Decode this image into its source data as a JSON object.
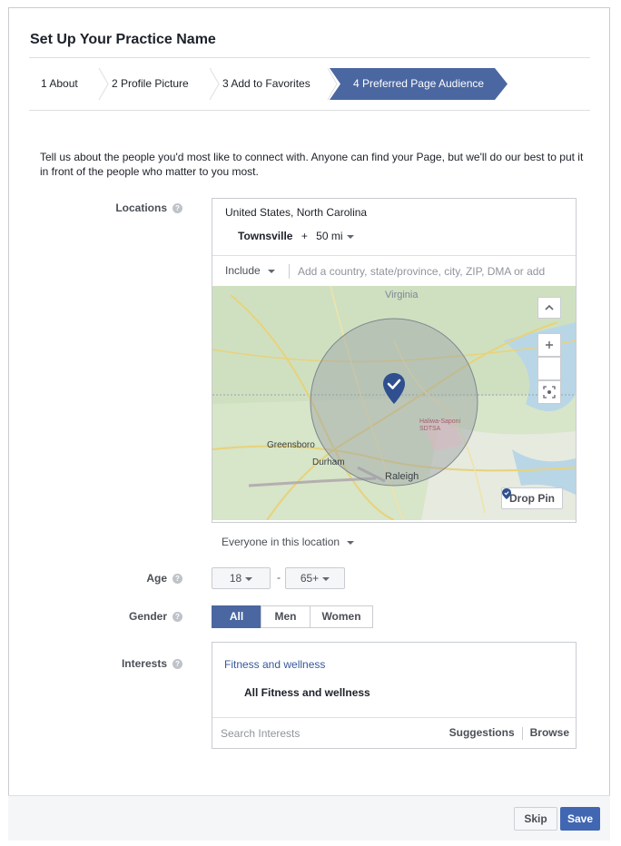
{
  "dialog": {
    "title": "Set Up Your Practice Name",
    "steps": [
      {
        "label": "1 About"
      },
      {
        "label": "2 Profile Picture"
      },
      {
        "label": "3 Add to Favorites"
      },
      {
        "label": "4 Preferred Page Audience"
      }
    ],
    "intro": "Tell us about the people you'd most like to connect with. Anyone can find your Page, but we'll do our best to put it in front of the people who matter to you most."
  },
  "locations": {
    "label": "Locations",
    "region": "United States, North Carolina",
    "city": "Townsville",
    "radius_prefix": "+",
    "radius": "50 mi",
    "include_label": "Include",
    "input_placeholder": "Add a country, state/province, city, ZIP, DMA or add",
    "map_labels": {
      "virginia": "Virginia",
      "greensboro": "Greensboro",
      "durham": "Durham",
      "raleigh": "Raleigh",
      "haliwa": "Haliwa-Saponi SDTSA"
    },
    "drop_pin_label": "Drop Pin",
    "everyone_label": "Everyone in this location"
  },
  "age": {
    "label": "Age",
    "min": "18",
    "max": "65+",
    "separator": "-"
  },
  "gender": {
    "label": "Gender",
    "options": [
      "All",
      "Men",
      "Women"
    ],
    "selected": "All"
  },
  "interests": {
    "label": "Interests",
    "category": "Fitness and wellness",
    "item": "All Fitness and wellness",
    "search_placeholder": "Search Interests",
    "suggestions_label": "Suggestions",
    "browse_label": "Browse"
  },
  "footer": {
    "skip_label": "Skip",
    "save_label": "Save"
  },
  "colors": {
    "accent": "#4b67a1",
    "save": "#4267b2",
    "link": "#365899",
    "pin": "#2f4f8f"
  }
}
